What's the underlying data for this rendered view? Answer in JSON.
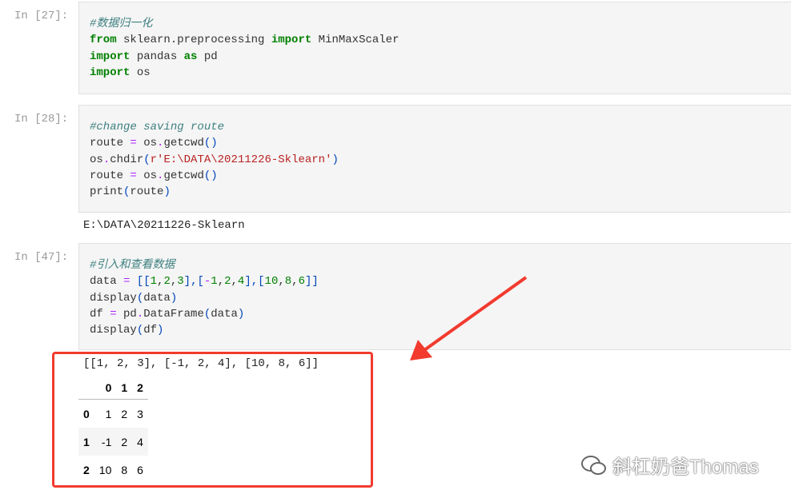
{
  "cells": [
    {
      "prompt": "In  [27]:",
      "lines": [
        [
          [
            "#数据归一化",
            "cm"
          ]
        ],
        [
          [
            "from",
            "kw"
          ],
          [
            " sklearn.preprocessing ",
            ""
          ],
          [
            "import",
            "kw"
          ],
          [
            " MinMaxScaler",
            ""
          ]
        ],
        [
          [
            "import",
            "kw"
          ],
          [
            " pandas ",
            ""
          ],
          [
            "as",
            "kw"
          ],
          [
            " pd",
            ""
          ]
        ],
        [
          [
            "import",
            "kw"
          ],
          [
            " os",
            ""
          ]
        ]
      ]
    },
    {
      "prompt": "In  [28]:",
      "lines": [
        [
          [
            "#change saving route",
            "cm"
          ]
        ],
        [
          [
            "route ",
            ""
          ],
          [
            "=",
            "op"
          ],
          [
            " os",
            ""
          ],
          [
            ".",
            "op"
          ],
          [
            "getcwd",
            ""
          ],
          [
            "()",
            "br"
          ]
        ],
        [
          [
            "os",
            ""
          ],
          [
            ".",
            "op"
          ],
          [
            "chdir",
            ""
          ],
          [
            "(",
            "br"
          ],
          [
            "r'E:\\DATA\\20211226-Sklearn'",
            "st"
          ],
          [
            ")",
            "br"
          ]
        ],
        [
          [
            "route ",
            ""
          ],
          [
            "=",
            "op"
          ],
          [
            " os",
            ""
          ],
          [
            ".",
            "op"
          ],
          [
            "getcwd",
            ""
          ],
          [
            "()",
            "br"
          ]
        ],
        [
          [
            "print",
            ""
          ],
          [
            "(",
            "br"
          ],
          [
            "route",
            ""
          ],
          [
            ")",
            "br"
          ]
        ]
      ],
      "output": "E:\\DATA\\20211226-Sklearn"
    },
    {
      "prompt": "In  [47]:",
      "lines": [
        [
          [
            "#引入和查看数据",
            "cm"
          ]
        ],
        [
          [
            "data ",
            ""
          ],
          [
            "=",
            "op"
          ],
          [
            " ",
            ""
          ],
          [
            "[[",
            "br"
          ],
          [
            "1",
            "nu"
          ],
          [
            ",",
            ""
          ],
          [
            "2",
            "nu"
          ],
          [
            ",",
            ""
          ],
          [
            "3",
            "nu"
          ],
          [
            "],[",
            "br"
          ],
          [
            "-",
            "op"
          ],
          [
            "1",
            "nu"
          ],
          [
            ",",
            ""
          ],
          [
            "2",
            "nu"
          ],
          [
            ",",
            ""
          ],
          [
            "4",
            "nu"
          ],
          [
            "],[",
            "br"
          ],
          [
            "10",
            "nu"
          ],
          [
            ",",
            ""
          ],
          [
            "8",
            "nu"
          ],
          [
            ",",
            ""
          ],
          [
            "6",
            "nu"
          ],
          [
            "]]",
            "br"
          ]
        ],
        [
          [
            "display",
            ""
          ],
          [
            "(",
            "br"
          ],
          [
            "data",
            ""
          ],
          [
            ")",
            "br"
          ]
        ],
        [
          [
            "df ",
            ""
          ],
          [
            "=",
            "op"
          ],
          [
            " pd",
            ""
          ],
          [
            ".",
            "op"
          ],
          [
            "DataFrame",
            ""
          ],
          [
            "(",
            "br"
          ],
          [
            "data",
            ""
          ],
          [
            ")",
            "br"
          ]
        ],
        [
          [
            "display",
            ""
          ],
          [
            "(",
            "br"
          ],
          [
            "df",
            ""
          ],
          [
            ")",
            "br"
          ]
        ]
      ],
      "output": "[[1, 2, 3], [-1, 2, 4], [10, 8, 6]]"
    }
  ],
  "dataframe": {
    "columns": [
      "",
      "0",
      "1",
      "2"
    ],
    "rows": [
      [
        "0",
        "1",
        "2",
        "3"
      ],
      [
        "1",
        "-1",
        "2",
        "4"
      ],
      [
        "2",
        "10",
        "8",
        "6"
      ]
    ]
  },
  "annotation_color": "#f23a2e",
  "watermark": "斜杠奶爸Thomas"
}
